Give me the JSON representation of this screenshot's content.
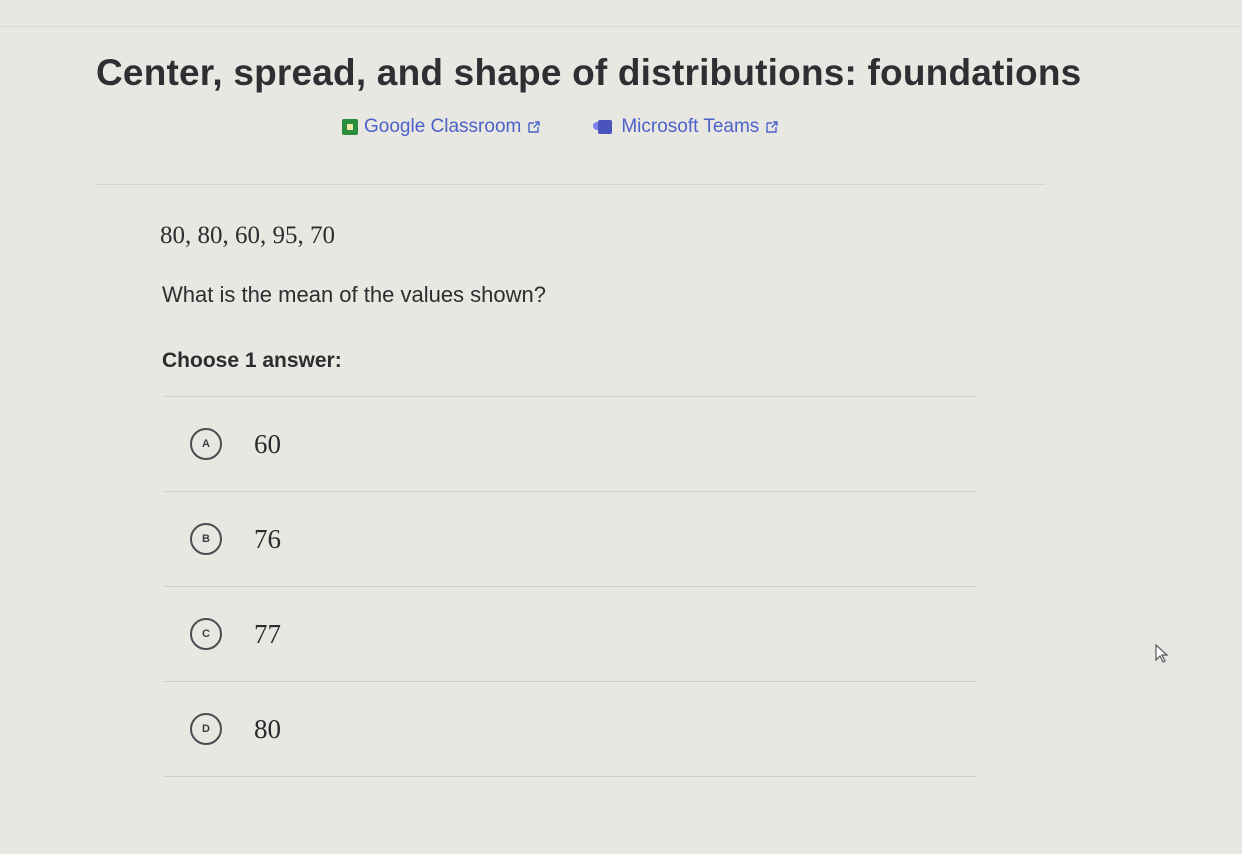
{
  "lesson": {
    "title": "Center, spread, and shape of distributions: foundations"
  },
  "share": {
    "google_classroom": {
      "label": "Google Classroom",
      "icon": "google-classroom-icon"
    },
    "microsoft_teams": {
      "label": "Microsoft Teams",
      "icon": "microsoft-teams-icon"
    },
    "external_icon": "external-link-icon"
  },
  "exercise": {
    "values_text": "80, 80, 60, 95, 70",
    "question": "What is the mean of the values shown?",
    "instruction": "Choose 1 answer:",
    "choices": [
      {
        "letter": "A",
        "value": "60"
      },
      {
        "letter": "B",
        "value": "76"
      },
      {
        "letter": "C",
        "value": "77"
      },
      {
        "letter": "D",
        "value": "80"
      }
    ]
  },
  "colors": {
    "link": "#4a62c9",
    "background": "#e9e7e2",
    "text": "#2b2d31"
  }
}
